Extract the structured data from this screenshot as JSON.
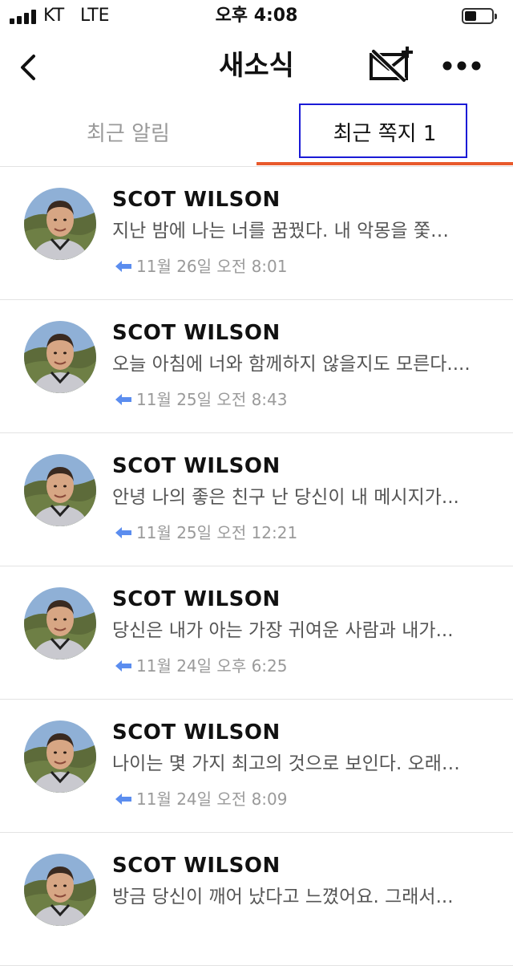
{
  "status_bar": {
    "carrier": "KT",
    "network": "LTE",
    "time": "오후 4:08",
    "battery_level": 0.45
  },
  "header": {
    "title": "새소식",
    "back_icon": "back-chevron-icon",
    "compose_icon": "new-message-icon",
    "more_icon": "more-dots-icon"
  },
  "tabs": [
    {
      "label": "최근 알림",
      "active": false
    },
    {
      "label": "최근 쪽지 1",
      "active": true
    }
  ],
  "colors": {
    "tab_underline": "#e85a2c",
    "reply_arrow": "#5b8def",
    "focus_box": "#1a1ad6"
  },
  "messages": [
    {
      "sender": "SCOT WILSON",
      "preview": "지난 밤에 나는 너를 꿈꿨다.   내 악몽을 쫓…",
      "date": "11월 26일 오전 8:01"
    },
    {
      "sender": "SCOT WILSON",
      "preview": "오늘 아침에 너와 함께하지 않을지도 모른다....",
      "date": "11월 25일 오전 8:43"
    },
    {
      "sender": "SCOT WILSON",
      "preview": "안녕 나의 좋은 친구 난 당신이 내 메시지가...",
      "date": "11월 25일 오전 12:21"
    },
    {
      "sender": "SCOT WILSON",
      "preview": "당신은 내가 아는 가장 귀여운 사람과 내가...",
      "date": "11월 24일 오후 6:25"
    },
    {
      "sender": "SCOT WILSON",
      "preview": "나이는 몇 가지 최고의 것으로 보인다.   오래…",
      "date": "11월 24일 오전 8:09"
    },
    {
      "sender": "SCOT WILSON",
      "preview": "방금 당신이 깨어 났다고 느꼈어요. 그래서...",
      "date": ""
    }
  ]
}
